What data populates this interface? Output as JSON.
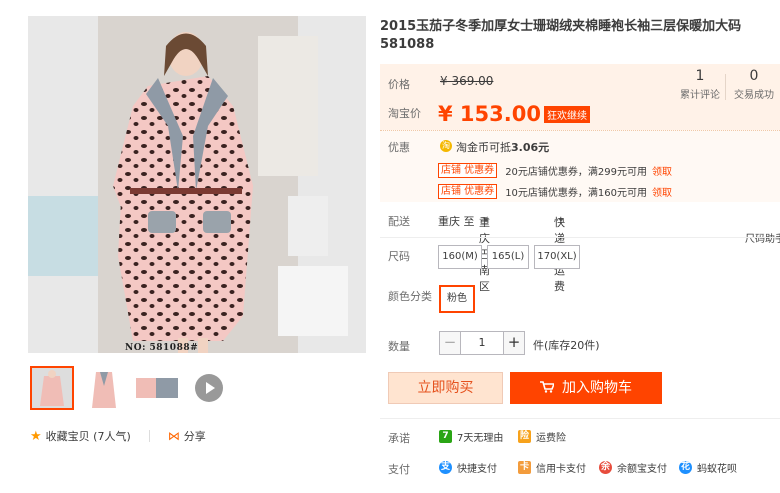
{
  "product": {
    "title": "2015玉茄子冬季加厚女士珊瑚绒夹棉睡袍长袖三层保暖加大码581088",
    "image_caption": "NO:    581088#"
  },
  "price": {
    "label": "价格",
    "original": "¥ 369.00",
    "tb_label": "淘宝价",
    "current": "¥ 153.00",
    "promo_tag": "狂欢继续"
  },
  "stats": [
    {
      "num": "1",
      "label": "累计评论"
    },
    {
      "num": "0",
      "label": "交易成功"
    }
  ],
  "promo": {
    "label": "优惠",
    "gold_icon": "淘",
    "gold_text_prefix": "淘金币可抵",
    "gold_amount": "3.06元",
    "coupons": [
      {
        "tag": "店铺 优惠券",
        "desc": "20元店铺优惠券，满299元可用",
        "claim": "领取"
      },
      {
        "tag": "店铺 优惠券",
        "desc": "10元店铺优惠券，满160元可用",
        "claim": "领取"
      }
    ]
  },
  "shipping": {
    "label": "配送",
    "from": "重庆 至",
    "to": "重庆巴南区",
    "method": "快递 免运费"
  },
  "size_helper": "尺码助手",
  "size": {
    "label": "尺码",
    "options": [
      "160(M)",
      "165(L)",
      "170(XL)"
    ]
  },
  "color": {
    "label": "颜色分类",
    "options": [
      "粉色"
    ]
  },
  "quantity": {
    "label": "数量",
    "minus": "−",
    "value": "1",
    "plus": "+",
    "stock": "件(库存20件)"
  },
  "actions": {
    "buy_now": "立即购买",
    "add_cart": "加入购物车"
  },
  "social": {
    "favorite": "收藏宝贝 (7人气)",
    "share": "分享"
  },
  "promise": {
    "label": "承诺",
    "items": [
      {
        "icon_text": "7",
        "icon_color": "#2aa515",
        "text": "7天无理由"
      },
      {
        "icon_text": "险",
        "icon_color": "#f7a21b",
        "text": "运费险"
      }
    ]
  },
  "payment": {
    "label": "支付",
    "items": [
      {
        "icon_text": "支",
        "icon_color": "#1e90ff",
        "text": "快捷支付"
      },
      {
        "icon_text": "卡",
        "icon_color": "#f39c3c",
        "text": "信用卡支付"
      },
      {
        "icon_text": "余",
        "icon_color": "#e74c3c",
        "text": "余额宝支付"
      },
      {
        "icon_text": "花",
        "icon_color": "#1e90ff",
        "text": "蚂蚁花呗"
      }
    ]
  },
  "colors": {
    "accent": "#ff4400",
    "price_bg": "#fff2e8",
    "buy_bg": "#ffe4d0"
  }
}
